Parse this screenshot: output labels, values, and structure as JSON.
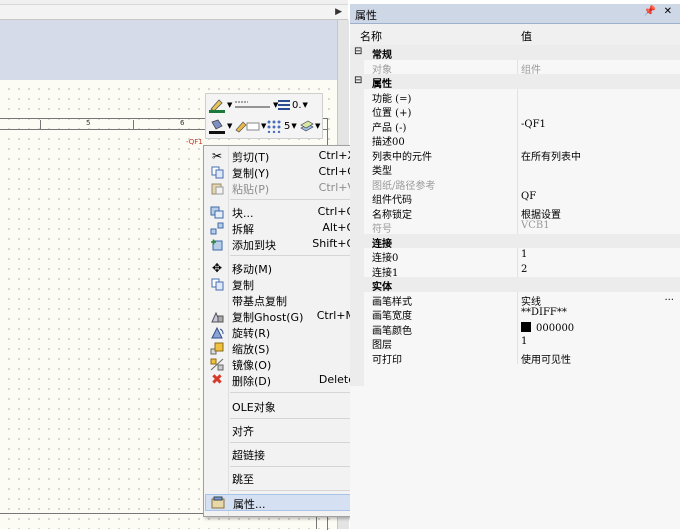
{
  "drawing": {
    "ruler_marks": [
      "5",
      "6"
    ],
    "component_tag": "-QF1",
    "mini_toolbar": {
      "line_weight": "0.",
      "hatch_number": "5"
    }
  },
  "context_menu": {
    "items": [
      {
        "label": "剪切(T)",
        "shortcut": "Ctrl+X",
        "icon": "scissors-icon"
      },
      {
        "label": "复制(Y)",
        "shortcut": "Ctrl+C",
        "icon": "copy-icon"
      },
      {
        "label": "粘贴(P)",
        "shortcut": "Ctrl+V",
        "icon": "paste-icon",
        "disabled": true
      },
      {
        "label": "块...",
        "shortcut": "Ctrl+G",
        "icon": "block-icon"
      },
      {
        "label": "拆解",
        "shortcut": "Alt+G",
        "icon": "explode-icon"
      },
      {
        "label": "添加到块",
        "shortcut": "Shift+G",
        "icon": "add-to-block-icon"
      },
      {
        "label": "移动(M)",
        "shortcut": "",
        "icon": "move-icon"
      },
      {
        "label": "复制",
        "shortcut": "",
        "icon": "duplicate-icon"
      },
      {
        "label": "带基点复制",
        "shortcut": "",
        "icon": ""
      },
      {
        "label": "复制Ghost(G)",
        "shortcut": "Ctrl+M",
        "icon": "ghost-copy-icon"
      },
      {
        "label": "旋转(R)",
        "shortcut": "",
        "icon": "rotate-icon"
      },
      {
        "label": "缩放(S)",
        "shortcut": "",
        "icon": "scale-icon"
      },
      {
        "label": "镜像(O)",
        "shortcut": "",
        "icon": "mirror-icon"
      },
      {
        "label": "删除(D)",
        "shortcut": "Delete",
        "icon": "delete-icon"
      },
      {
        "label": "OLE对象",
        "submenu": true
      },
      {
        "label": "对齐",
        "submenu": true
      },
      {
        "label": "超链接",
        "submenu": true
      },
      {
        "label": "跳至",
        "submenu": true
      },
      {
        "label": "属性...",
        "shortcut": "",
        "icon": "properties-icon",
        "highlighted": true
      }
    ]
  },
  "properties": {
    "title": "属性",
    "col_name": "名称",
    "col_value": "值",
    "cat_general": "常规",
    "cat_attributes": "属性",
    "cat_connection": "连接",
    "cat_entity": "实体",
    "rows": {
      "object": {
        "name": "对象",
        "value": "组件"
      },
      "function": {
        "name": "功能 (=)",
        "value": ""
      },
      "location": {
        "name": "位置 (+)",
        "value": ""
      },
      "product": {
        "name": "产品 (-)",
        "value": "-QF1"
      },
      "desc": {
        "name": "描述00",
        "value": ""
      },
      "in_list": {
        "name": "列表中的元件",
        "value": "在所有列表中"
      },
      "type": {
        "name": "类型",
        "value": ""
      },
      "sheet_ref": {
        "name": "图纸/路径参考",
        "value": ""
      },
      "comp_code": {
        "name": "组件代码",
        "value": "QF"
      },
      "name_lock": {
        "name": "名称锁定",
        "value": "根据设置"
      },
      "symbol": {
        "name": "符号",
        "value": "VCB1"
      },
      "conn0": {
        "name": "连接0",
        "value": "1"
      },
      "conn1": {
        "name": "连接1",
        "value": "2"
      },
      "pen_style": {
        "name": "画笔样式",
        "value": "实线",
        "extra": "..."
      },
      "pen_width": {
        "name": "画笔宽度",
        "value": "**DIFF**"
      },
      "pen_color": {
        "name": "画笔颜色",
        "value": "000000",
        "color": "#000000"
      },
      "layer": {
        "name": "图层",
        "value": "1"
      },
      "printable": {
        "name": "可打印",
        "value": "使用可见性"
      }
    }
  }
}
